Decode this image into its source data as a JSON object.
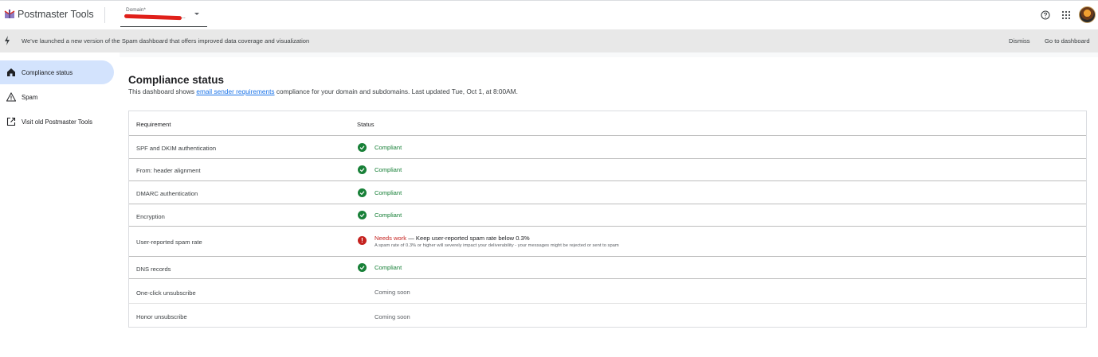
{
  "app": {
    "title": "Postmaster Tools",
    "domain_label": "Domain*",
    "domain_ellipsis": "..."
  },
  "banner": {
    "text": "We've launched a new version of the Spam dashboard that offers improved data coverage and visualization",
    "dismiss": "Dismiss",
    "go": "Go to dashboard"
  },
  "sidebar": {
    "items": [
      {
        "label": "Compliance status",
        "icon": "home-icon",
        "active": true
      },
      {
        "label": "Spam",
        "icon": "warning-icon",
        "active": false
      },
      {
        "label": "Visit old Postmaster Tools",
        "icon": "open-in-new-icon",
        "active": false
      }
    ]
  },
  "main": {
    "title": "Compliance status",
    "subtitle_before": "This dashboard shows ",
    "subtitle_link": "email sender requirements",
    "subtitle_after": " compliance for your domain and subdomains. Last updated Tue, Oct 1, at 8:00AM.",
    "table": {
      "headers": [
        "Requirement",
        "Status"
      ],
      "rows": [
        {
          "requirement": "SPF and DKIM authentication",
          "status": "Compliant"
        },
        {
          "requirement": "From: header alignment",
          "status": "Compliant"
        },
        {
          "requirement": "DMARC authentication",
          "status": "Compliant"
        },
        {
          "requirement": "Encryption",
          "status": "Compliant"
        },
        {
          "requirement": "User-reported spam rate",
          "status": "Needs work",
          "status_detail": " — Keep user-reported spam rate below 0.3%",
          "note": "A spam rate of 0.3% or higher will severely impact your deliverability - your messages might be rejected or sent to spam"
        },
        {
          "requirement": "DNS records",
          "status": "Compliant"
        },
        {
          "requirement": "One-click unsubscribe",
          "status": "Coming soon"
        },
        {
          "requirement": "Honor unsubscribe",
          "status": "Coming soon"
        }
      ]
    }
  },
  "colors": {
    "compliant": "#188038",
    "needs_work": "#c5221f",
    "link": "#1a73e8",
    "nav_active": "#d3e3fd"
  }
}
